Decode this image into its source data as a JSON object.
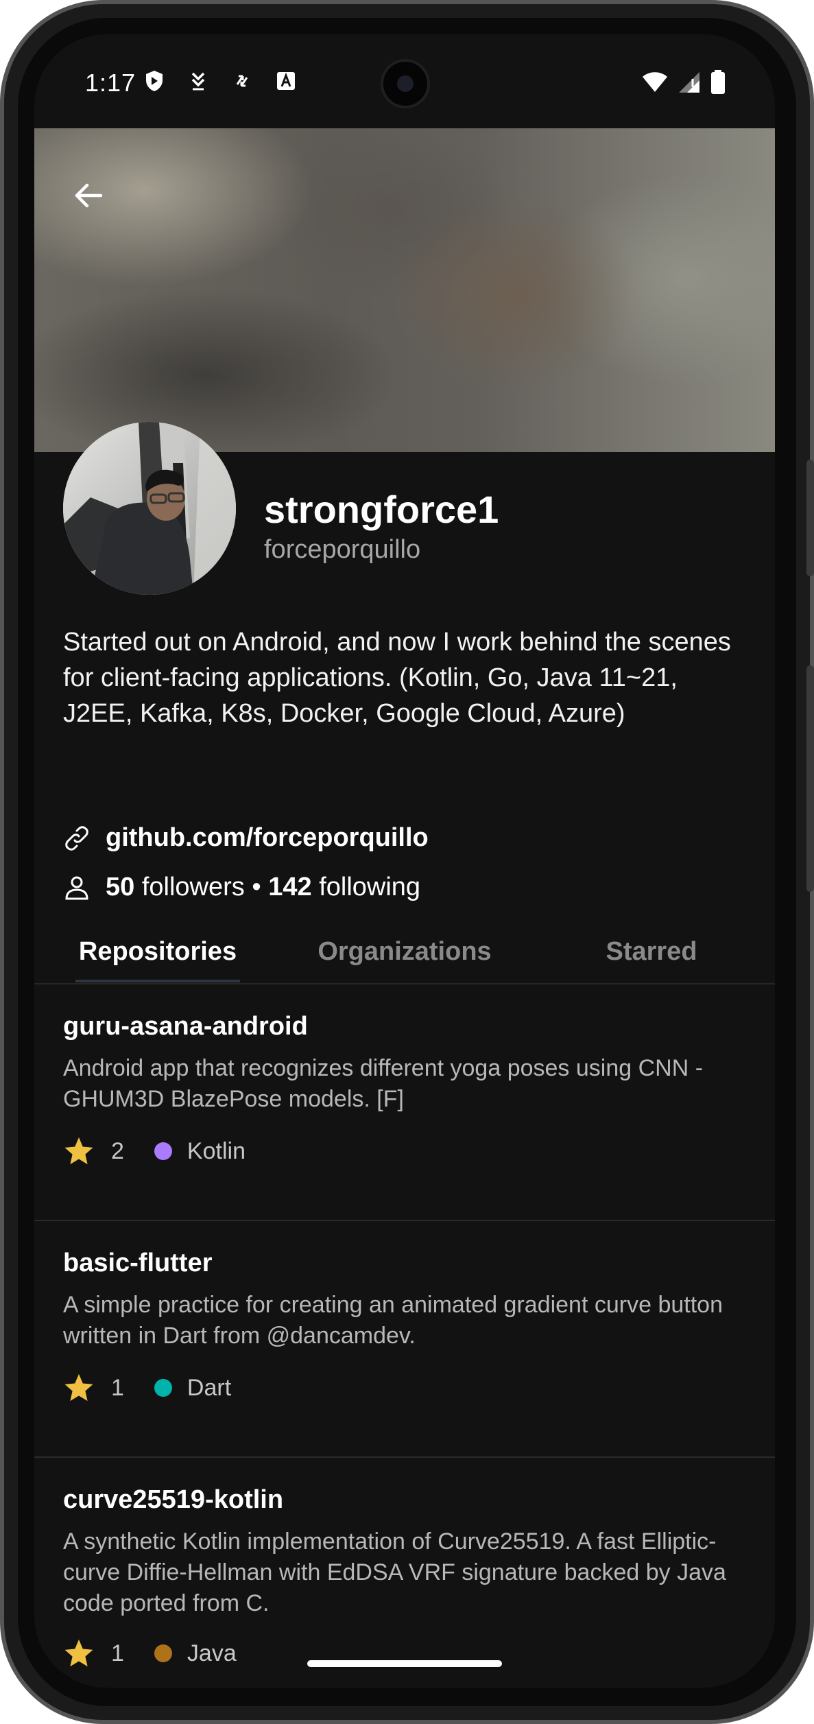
{
  "status_bar": {
    "time": "1:17",
    "left_icons": [
      "shield-icon",
      "download-icon",
      "sync-icon",
      "font-icon"
    ],
    "right_icons": [
      "wifi-icon",
      "signal-icon",
      "battery-icon"
    ]
  },
  "profile": {
    "display_name": "strongforce1",
    "username": "forceporquillo",
    "bio": "Started out on Android, and now I work behind the scenes for client-facing applications. (Kotlin, Go, Java 11~21, J2EE, Kafka, K8s, Docker, Google Cloud, Azure)",
    "link": "github.com/forceporquillo",
    "followers_count": "50",
    "followers_label": "followers",
    "separator": "•",
    "following_count": "142",
    "following_label": "following"
  },
  "tabs": [
    {
      "label": "Repositories",
      "active": true
    },
    {
      "label": "Organizations",
      "active": false
    },
    {
      "label": "Starred",
      "active": false
    }
  ],
  "repositories": [
    {
      "name": "guru-asana-android",
      "description": "Android app that recognizes different yoga poses using CNN - GHUM3D BlazePose models. [F]",
      "stars": "2",
      "language": "Kotlin",
      "language_color": "#a97bff"
    },
    {
      "name": "basic-flutter",
      "description": "A simple practice for creating an animated gradient curve button written in Dart from @dancamdev.",
      "stars": "1",
      "language": "Dart",
      "language_color": "#00b4ab"
    },
    {
      "name": "curve25519-kotlin",
      "description": "A synthetic Kotlin implementation of Curve25519. A fast Elliptic-curve Diffie-Hellman with EdDSA VRF signature backed by Java code ported from C.",
      "stars": "1",
      "language": "Java",
      "language_color": "#b07219"
    }
  ],
  "colors": {
    "background": "#121212",
    "star": "#f0c043",
    "secondary_text": "#a8a8a8"
  }
}
